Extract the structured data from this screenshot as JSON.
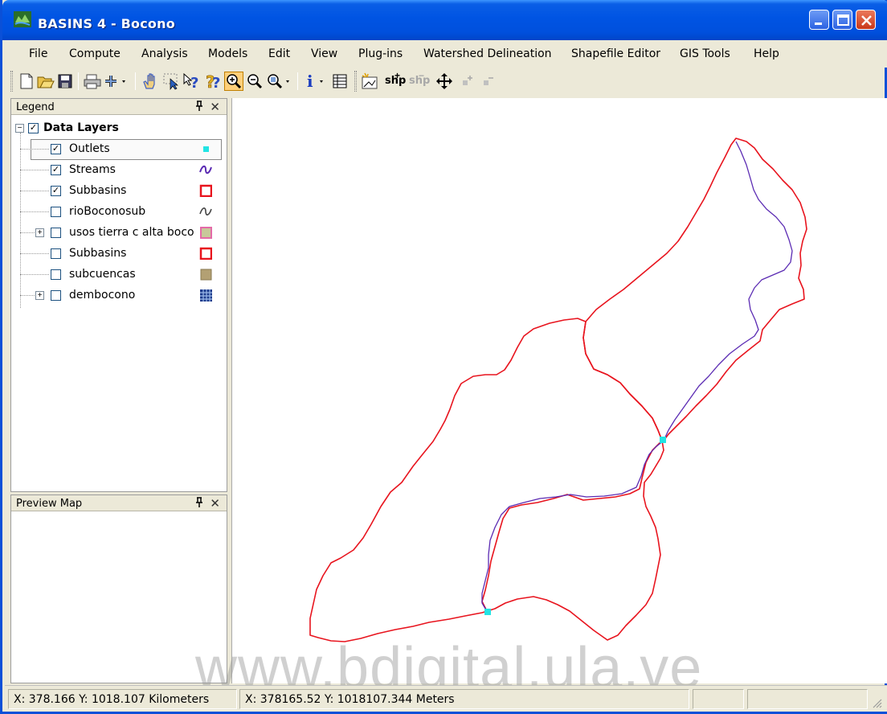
{
  "window": {
    "title": "BASINS 4  - Bocono"
  },
  "menu": [
    "File",
    "Compute",
    "Analysis",
    "Models",
    "Edit",
    "View",
    "Plug-ins",
    "Watershed Delineation",
    "Shapefile Editor",
    "GIS Tools",
    "Help"
  ],
  "toolbar": {
    "icons": [
      "new-icon",
      "open-icon",
      "save-icon",
      "print-icon",
      "add-layer-icon",
      "pan-icon",
      "select-icon",
      "identify-help-icon",
      "context-help-icon",
      "zoom-in-icon",
      "zoom-out-icon",
      "zoom-extent-icon",
      "info-icon",
      "attribute-table-icon",
      "new-shapefile-icon",
      "add-shape-icon",
      "remove-shape-icon",
      "move-shape-icon",
      "add-vertex-icon",
      "remove-vertex-icon"
    ],
    "shp_label": "shp",
    "shp_disabled_label": "shp"
  },
  "legend": {
    "title": "Legend",
    "pin": "д",
    "close": "✕",
    "group": "Data Layers",
    "layers": [
      {
        "name": "Outlets",
        "checked": true,
        "symbol": "point-square",
        "color": "#22e4e4"
      },
      {
        "name": "Streams",
        "checked": true,
        "symbol": "line-wave",
        "color": "#5b2bb3"
      },
      {
        "name": "Subbasins",
        "checked": true,
        "symbol": "polygon-outline",
        "color": "#e8141e"
      },
      {
        "name": "rioBoconosub",
        "checked": false,
        "symbol": "line-wave",
        "color": "#444444"
      },
      {
        "name": "usos tierra c alta boco",
        "checked": false,
        "symbol": "polygon-fill",
        "color": "#e4a0c8",
        "expandable": true
      },
      {
        "name": "Subbasins",
        "checked": false,
        "symbol": "polygon-outline",
        "color": "#e8141e"
      },
      {
        "name": "subcuencas",
        "checked": false,
        "symbol": "polygon-fill",
        "color": "#b3a073"
      },
      {
        "name": "dembocono",
        "checked": false,
        "symbol": "grid",
        "color": "#1e3c8c",
        "expandable": true
      }
    ]
  },
  "preview": {
    "title": "Preview Map",
    "pin": "д",
    "close": "✕"
  },
  "status": {
    "km": "X: 378.166   Y: 1018.107 Kilometers",
    "m": "X: 378165.52   Y: 1018107.344 Meters"
  },
  "watermark": "www.bdigital.ula.ve",
  "colors": {
    "subbasin": "#e8141e",
    "stream": "#5b2bb3",
    "outlet": "#22e4e4"
  }
}
